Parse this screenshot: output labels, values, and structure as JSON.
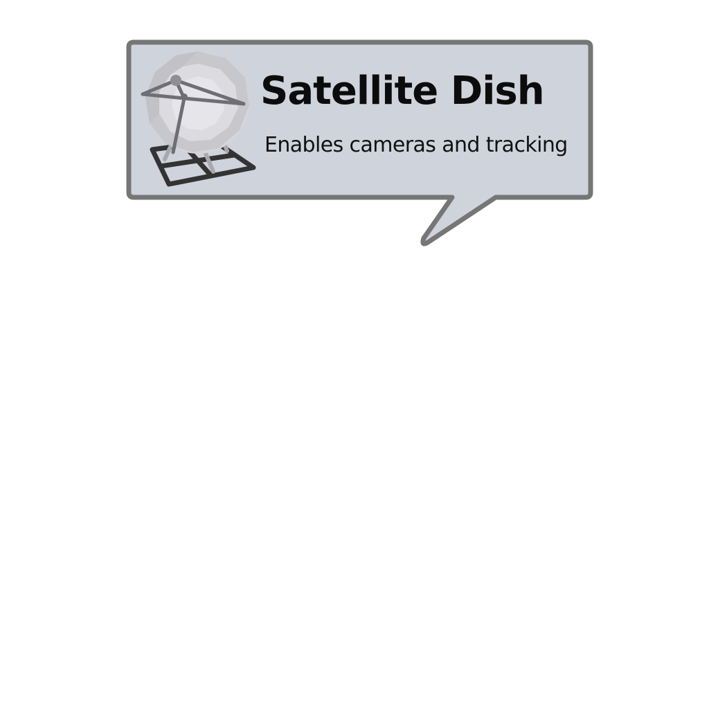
{
  "tooltip": {
    "title": "Satellite Dish",
    "description": "Enables cameras and tracking",
    "icon": "satellite-dish-icon",
    "colors": {
      "background": "#cfd3dc",
      "border": "#767676",
      "text": "#0c0c0c"
    }
  }
}
